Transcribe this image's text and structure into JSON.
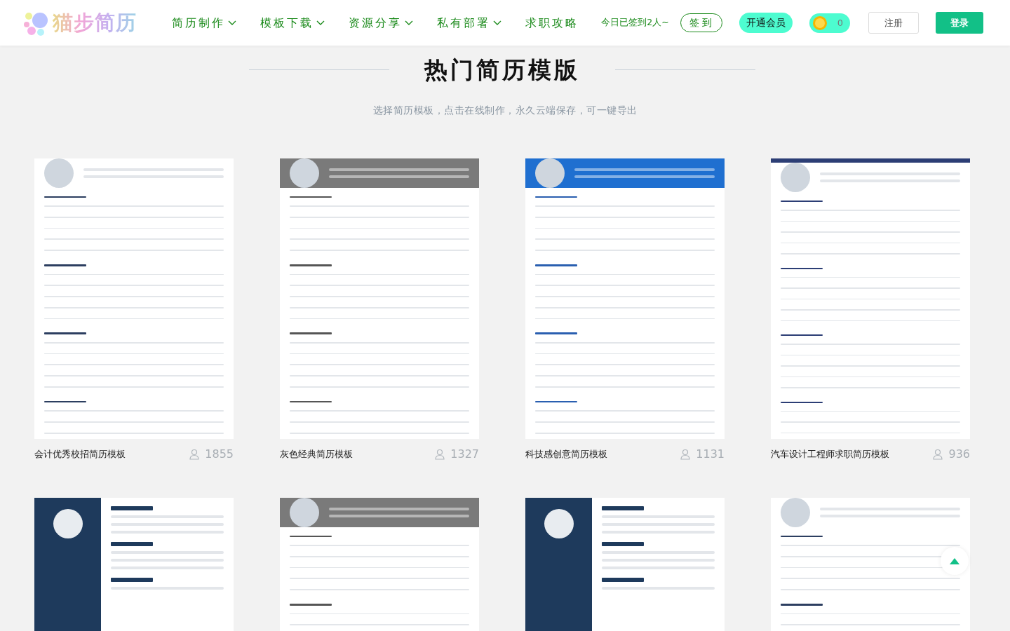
{
  "logo": {
    "text": "猫步简历"
  },
  "nav": [
    {
      "label": "简历制作",
      "dropdown": true
    },
    {
      "label": "模板下载",
      "dropdown": true
    },
    {
      "label": "资源分享",
      "dropdown": true
    },
    {
      "label": "私有部署",
      "dropdown": true
    },
    {
      "label": "求职攻略",
      "dropdown": false
    }
  ],
  "checkin": {
    "note": "今日已签到2人~",
    "button": "签到"
  },
  "vip_button": "开通会员",
  "coins": {
    "count": "0"
  },
  "register_button": "注册",
  "login_button": "登录",
  "section": {
    "title": "热门简历模版",
    "subtitle": "选择简历模板，点击在线制作，永久云端保存，可一键导出"
  },
  "templates": [
    {
      "title": "会计优秀校招简历模板",
      "views": "1855",
      "kind": "plain"
    },
    {
      "title": "灰色经典简历模板",
      "views": "1327",
      "kind": "grey"
    },
    {
      "title": "科技感创意简历模板",
      "views": "1131",
      "kind": "blue"
    },
    {
      "title": "汽车设计工程师求职简历模板",
      "views": "936",
      "kind": "banner"
    }
  ],
  "more_templates": [
    {
      "kind": "sidebar"
    },
    {
      "kind": "grey"
    },
    {
      "kind": "sidebar"
    },
    {
      "kind": "plain"
    }
  ]
}
